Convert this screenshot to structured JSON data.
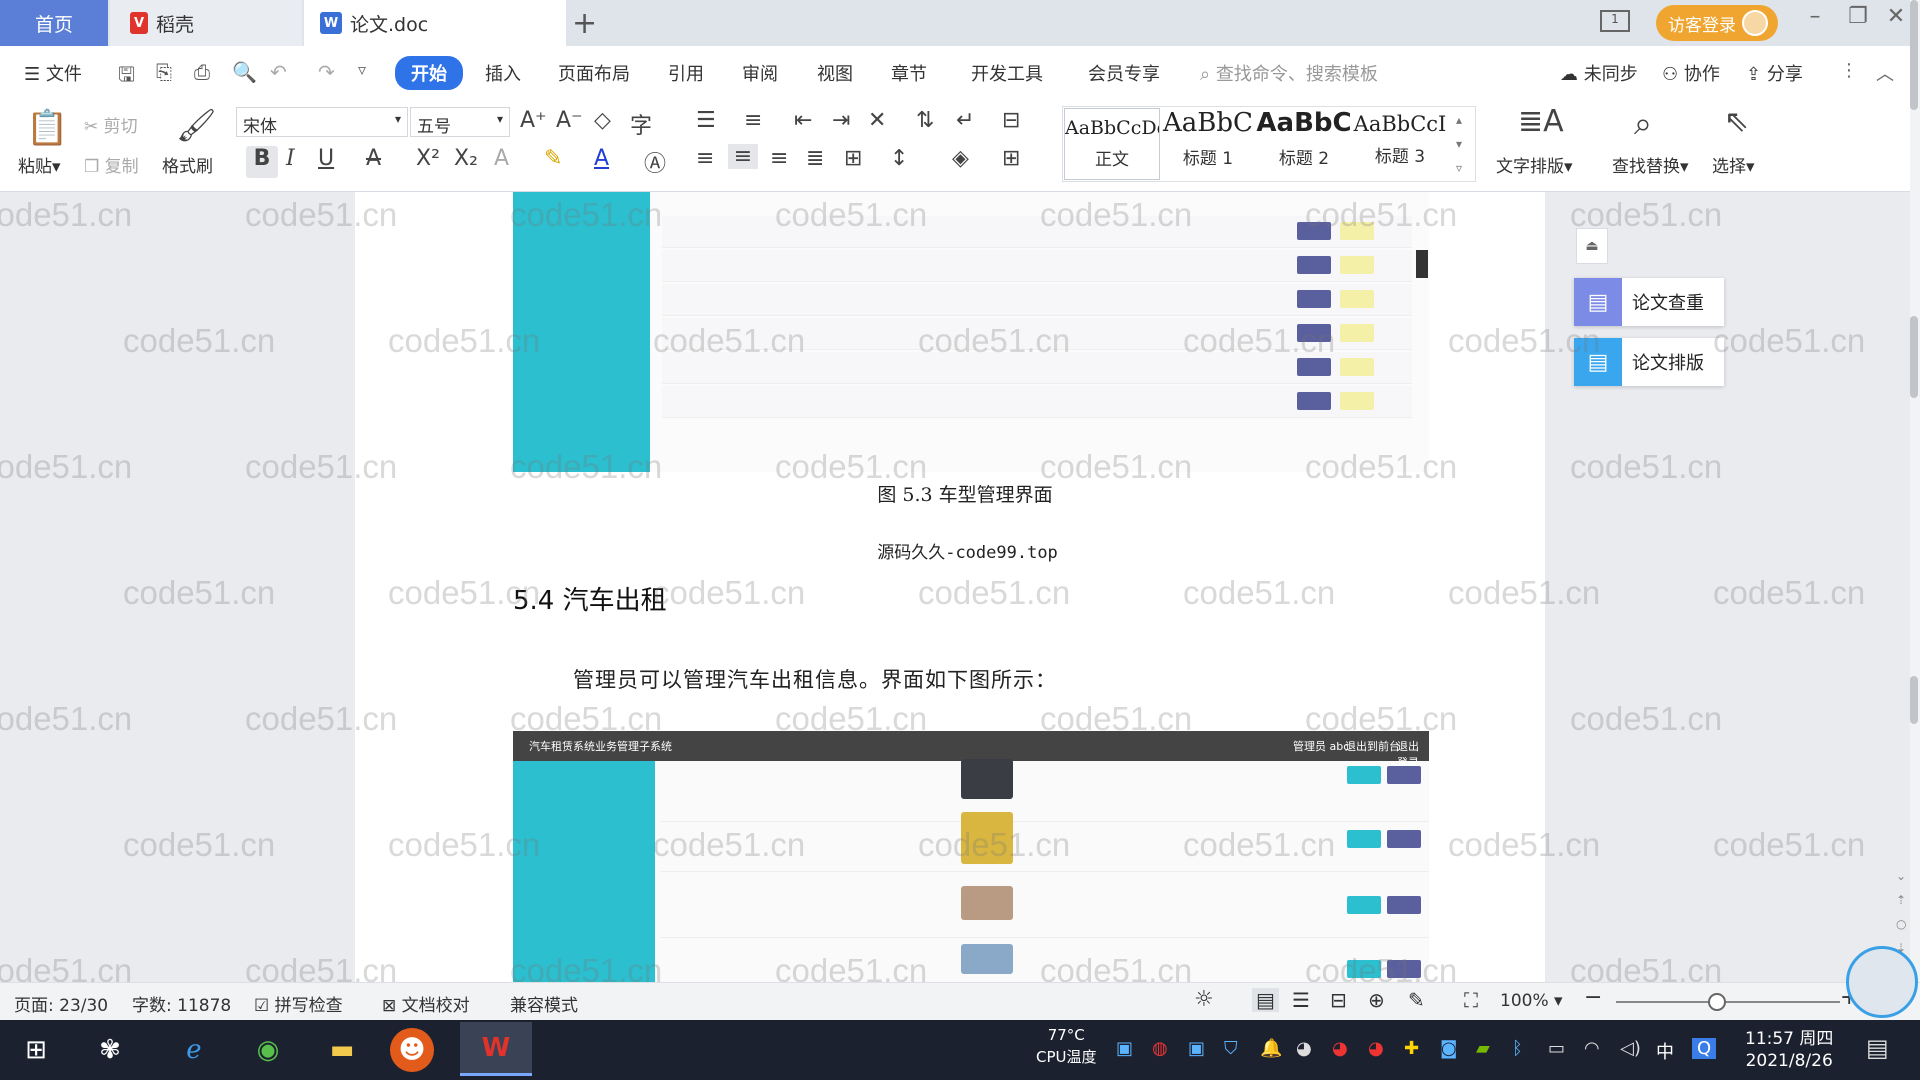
{
  "tabs": {
    "home": "首页",
    "daoke": "稻壳",
    "doc": "论文.doc"
  },
  "titlebar": {
    "visitor_login": "访客登录",
    "page_count_icon": "1"
  },
  "menu": {
    "file": "文件",
    "items": [
      "开始",
      "插入",
      "页面布局",
      "引用",
      "审阅",
      "视图",
      "章节",
      "开发工具",
      "会员专享"
    ],
    "search_placeholder": "查找命令、搜索模板",
    "unsynced": "未同步",
    "collaborate": "协作",
    "share": "分享"
  },
  "ribbon": {
    "paste": "粘贴",
    "cut": "剪切",
    "copy": "复制",
    "format_painter": "格式刷",
    "font_name": "宋体",
    "font_size": "五号",
    "styles": [
      {
        "sample": "AaBbCcDd",
        "label": "正文"
      },
      {
        "sample": "AaBbC",
        "label": "标题 1"
      },
      {
        "sample": "AaBbC",
        "label": "标题 2"
      },
      {
        "sample": "AaBbCcI",
        "label": "标题 3"
      }
    ],
    "text_layout": "文字排版",
    "find_replace": "查找替换",
    "select": "选择"
  },
  "side_panel": {
    "plagiarism_check": "论文查重",
    "paper_layout": "论文排版"
  },
  "document": {
    "figure_caption": "图 5.3  车型管理界面",
    "source_line": "源码久久-code99.top",
    "section_heading": "5.4  汽车出租",
    "body_paragraph": "管理员可以管理汽车出租信息。界面如下图所示：",
    "embedded_app_title": "汽车租赁系统业务管理子系统",
    "embedded_app_user": "管理员 abc",
    "embedded_app_logout": "退出到前台",
    "embedded_app_exit": "退出登录"
  },
  "watermark": "code51.cn",
  "statusbar": {
    "page": "页面: 23/30",
    "words": "字数: 11878",
    "spellcheck": "拼写检查",
    "proofread": "文档校对",
    "compat_mode": "兼容模式",
    "zoom": "100%"
  },
  "taskbar": {
    "cpu_temp": "77°C",
    "cpu_label": "CPU温度",
    "ime": "中",
    "time": "11:57 周四",
    "date": "2021/8/26"
  },
  "colors": {
    "accent": "#2f73e8",
    "sidebar_teal": "#2bbfcf",
    "visitor_orange": "#f0a531",
    "home_tab": "#5b7fd6"
  }
}
